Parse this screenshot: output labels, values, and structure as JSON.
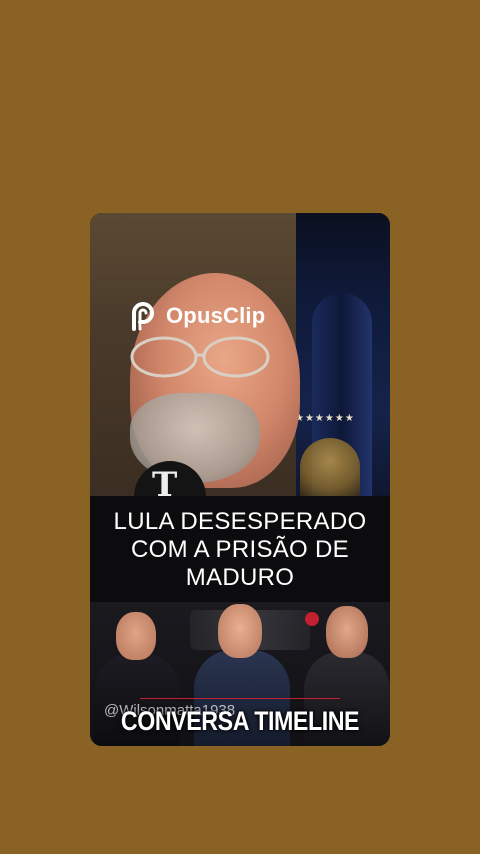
{
  "watermark": {
    "brand": "OpusClip",
    "icon": "opusclip-logo-icon"
  },
  "headline": {
    "lines": [
      "LULA DESESPERADO",
      "COM A PRISÃO DE",
      "MADURO"
    ]
  },
  "thumbnail": {
    "handle": "@Wilsonmatta1938",
    "title": "CONVERSA TIMELINE"
  },
  "colors": {
    "background": "#8a6223",
    "caption_bg": "#0c0c0e",
    "accent": "#c02030"
  }
}
